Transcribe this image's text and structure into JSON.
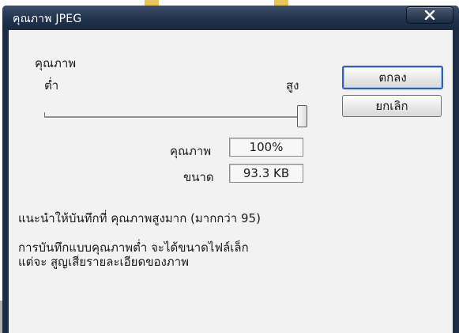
{
  "window": {
    "title": "คุณภาพ JPEG"
  },
  "quality_section": {
    "label": "คุณภาพ",
    "min_label": "ต่ำ",
    "max_label": "สูง",
    "slider_value_percent": 100
  },
  "readouts": {
    "quality_label": "คุณภาพ",
    "quality_value": "100%",
    "size_label": "ขนาด",
    "size_value": "93.3 KB"
  },
  "buttons": {
    "ok": "ตกลง",
    "cancel": "ยกเลิก"
  },
  "notes": {
    "recommendation": "แนะนำให้บันทึกที่ คุณภาพสูงมาก (มากกว่า 95)",
    "info_line1": "การบันทึกแบบคุณภาพต่ำ จะได้ขนาดไฟล์เล็ก",
    "info_line2": "แต่จะ สูญเสียรายละเอียดของภาพ"
  },
  "icons": {
    "close": "close-icon"
  },
  "colors": {
    "titlebar": "#22334d",
    "client_bg": "#f2f2f2",
    "default_button_border": "#3a5fae"
  }
}
